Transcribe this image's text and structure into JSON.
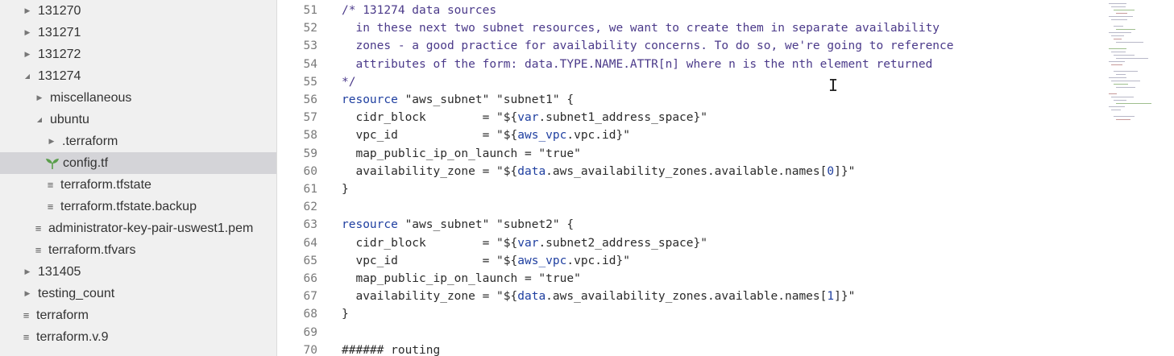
{
  "tree": {
    "items": [
      {
        "label": "131270",
        "kind": "folder",
        "state": "collapsed"
      },
      {
        "label": "131271",
        "kind": "folder",
        "state": "collapsed"
      },
      {
        "label": "131272",
        "kind": "folder",
        "state": "collapsed"
      },
      {
        "label": "131274",
        "kind": "folder",
        "state": "expanded"
      },
      {
        "label": "miscellaneous",
        "kind": "folder",
        "state": "collapsed"
      },
      {
        "label": "ubuntu",
        "kind": "folder",
        "state": "expanded"
      },
      {
        "label": ".terraform",
        "kind": "folder",
        "state": "collapsed"
      },
      {
        "label": "config.tf",
        "kind": "file-terraform",
        "state": "selected"
      },
      {
        "label": "terraform.tfstate",
        "kind": "file"
      },
      {
        "label": "terraform.tfstate.backup",
        "kind": "file"
      },
      {
        "label": "administrator-key-pair-uswest1.pem",
        "kind": "file"
      },
      {
        "label": "terraform.tfvars",
        "kind": "file"
      },
      {
        "label": "131405",
        "kind": "folder",
        "state": "collapsed"
      },
      {
        "label": "testing_count",
        "kind": "folder",
        "state": "collapsed"
      },
      {
        "label": "terraform",
        "kind": "file"
      },
      {
        "label": "terraform.v.9",
        "kind": "file"
      }
    ]
  },
  "editor": {
    "lines": [
      {
        "no": "51",
        "text": "/* 131274 data sources"
      },
      {
        "no": "52",
        "text": "  in these next two subnet resources, we want to create them in separate availability"
      },
      {
        "no": "53",
        "text": "  zones - a good practice for availability concerns. To do so, we're going to reference"
      },
      {
        "no": "54",
        "text": "  attributes of the form: data.TYPE.NAME.ATTR[n] where n is the nth element returned"
      },
      {
        "no": "55",
        "text": "*/"
      },
      {
        "no": "56",
        "text": "resource \"aws_subnet\" \"subnet1\" {"
      },
      {
        "no": "57",
        "text": "  cidr_block        = \"${var.subnet1_address_space}\""
      },
      {
        "no": "58",
        "text": "  vpc_id            = \"${aws_vpc.vpc.id}\""
      },
      {
        "no": "59",
        "text": "  map_public_ip_on_launch = \"true\""
      },
      {
        "no": "60",
        "text": "  availability_zone = \"${data.aws_availability_zones.available.names[0]}\""
      },
      {
        "no": "61",
        "text": "}"
      },
      {
        "no": "62",
        "text": ""
      },
      {
        "no": "63",
        "text": "resource \"aws_subnet\" \"subnet2\" {"
      },
      {
        "no": "64",
        "text": "  cidr_block        = \"${var.subnet2_address_space}\""
      },
      {
        "no": "65",
        "text": "  vpc_id            = \"${aws_vpc.vpc.id}\""
      },
      {
        "no": "66",
        "text": "  map_public_ip_on_launch = \"true\""
      },
      {
        "no": "67",
        "text": "  availability_zone = \"${data.aws_availability_zones.available.names[1]}\""
      },
      {
        "no": "68",
        "text": "}"
      },
      {
        "no": "69",
        "text": ""
      },
      {
        "no": "70",
        "text": "###### routing"
      }
    ]
  },
  "colors": {
    "sidebar_bg": "#f0f0f0",
    "selected_row": "#d4d4d8",
    "keyword": "#1f3fa0",
    "comment": "#4b3a8a",
    "terraform_icon": "#5a9e4b"
  }
}
